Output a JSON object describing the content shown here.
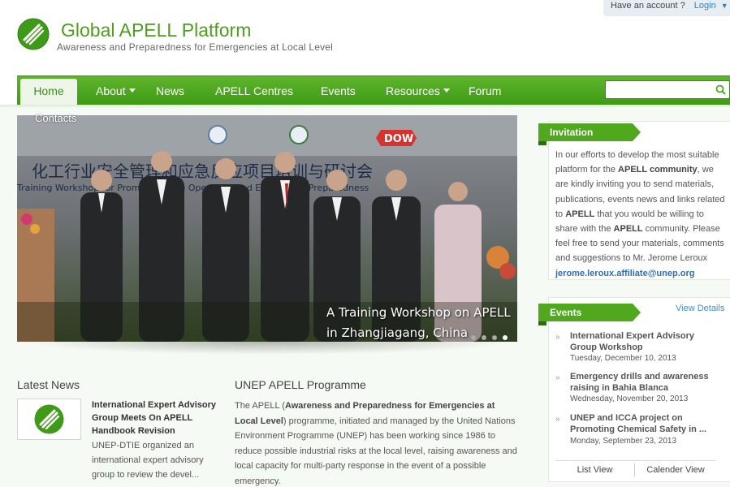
{
  "account": {
    "question": "Have an account ?",
    "login": "Login"
  },
  "site": {
    "title": "Global APELL Platform",
    "subtitle": "Awareness and Preparedness for Emergencies at Local Level"
  },
  "nav": {
    "items": [
      {
        "label": "Home",
        "active": true
      },
      {
        "label": "About",
        "dropdown": true
      },
      {
        "label": "News"
      },
      {
        "label": "APELL Centres"
      },
      {
        "label": "Events"
      },
      {
        "label": "Resources",
        "dropdown": true
      },
      {
        "label": "Forum"
      },
      {
        "label": "Contacts"
      }
    ],
    "search_placeholder": ""
  },
  "slider": {
    "caption_line1": "A Training Workshop on APELL",
    "caption_line2": "in Zhangjiagang, China",
    "banner_text": "化工行业安全管理和应急反应项目培训与研讨会",
    "banner_sub": "Training Workshop for Promoting Safe Operation and Emergency Preparedness",
    "dot_count": 4,
    "active_dot": 4
  },
  "latest_news": {
    "heading": "Latest News",
    "title": "International Expert Advisory Group Meets On APELL Handbook Revision",
    "excerpt": "UNEP-DTIE organized an international expert advisory group to review the devel..."
  },
  "programme": {
    "heading": "UNEP APELL Programme",
    "p1": "The APELL (",
    "p1_bold": "Awareness and Preparedness for Emergencies at Local Level",
    "p2": ") programme, initiated and managed by the United Nations Environment Programme (UNEP) has been working since 1986 to reduce possible industrial risks at the local level, raising awareness and local capacity for multi-party response in the event of a possible emergency."
  },
  "invitation": {
    "heading": "Invitation",
    "t1": "In our efforts to develop the most suitable platform for the ",
    "b1": "APELL community",
    "t2": ", we are kindly inviting you to send materials, publications, events news and links related to ",
    "b2": "APELL",
    "t3": " that you would be willing to share with the ",
    "b3": "APELL",
    "t4": " community. Please feel free to send your materials, comments and suggestions to Mr. Jerome Leroux ",
    "email": "jerome.leroux.affiliate@unep.org"
  },
  "events": {
    "heading": "Events",
    "view_details": "View Details",
    "items": [
      {
        "title": "International Expert Advisory Group Workshop",
        "date": "Tuesday, December 10, 2013"
      },
      {
        "title": "Emergency drills and awareness raising in Bahia Blanca",
        "date": "Wednesday, November 20, 2013"
      },
      {
        "title": "UNEP and ICCA project on Promoting Chemical Safety in ...",
        "date": "Monday, September 23, 2013"
      }
    ],
    "list_view": "List View",
    "calendar_view": "Calender View"
  },
  "colors": {
    "brand_green": "#4d9e1c",
    "nav_green": "#4fa81e",
    "link_blue": "#2f6fb5"
  }
}
